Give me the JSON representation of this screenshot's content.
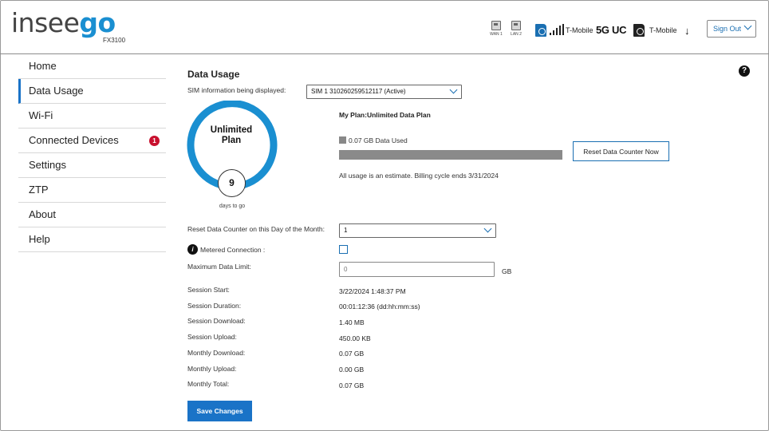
{
  "header": {
    "logo_prefix": "insee",
    "logo_suffix": "go",
    "model": "FX3100",
    "wan_label": "WAN 1",
    "lan_label": "LAN 2",
    "carrier1": "T-Mobile",
    "network_type": "5G UC",
    "carrier2": "T-Mobile",
    "download_arrow": "↓",
    "sign_out": "Sign Out"
  },
  "sidebar": {
    "items": [
      {
        "label": "Home"
      },
      {
        "label": "Data Usage",
        "active": true
      },
      {
        "label": "Wi-Fi"
      },
      {
        "label": "Connected Devices",
        "badge": "1"
      },
      {
        "label": "Settings"
      },
      {
        "label": "ZTP"
      },
      {
        "label": "About"
      },
      {
        "label": "Help"
      }
    ]
  },
  "help_icon": "?",
  "main": {
    "title": "Data Usage",
    "sim_label": "SIM information being displayed:",
    "sim_value": "SIM 1 310260259512117 (Active)",
    "gauge": {
      "plan_text": "Unlimited\nPlan",
      "days": "9",
      "days_label": "days to go",
      "ring_color": "#1a8fd1"
    },
    "plan_title": "My Plan:Unlimited Data Plan",
    "data_used": "0.07 GB Data Used",
    "usage_fraction": 0.0,
    "reset_counter_button": "Reset Data Counter Now",
    "estimate": "All usage is an estimate. Billing cycle ends 3/31/2024",
    "reset_day_label": "Reset Data Counter on this Day of the Month:",
    "reset_day_value": "1",
    "metered_label": "Metered Connection :",
    "metered_checked": false,
    "max_limit_label": "Maximum Data Limit:",
    "max_limit_placeholder": "0",
    "max_limit_unit": "GB",
    "stats": [
      {
        "label": "Session Start:",
        "value": "3/22/2024 1:48:37 PM"
      },
      {
        "label": "Session Duration:",
        "value": "00:01:12:36 (dd:hh:mm:ss)"
      },
      {
        "label": "Session Download:",
        "value": "1.40 MB"
      },
      {
        "label": "Session Upload:",
        "value": "450.00 KB"
      },
      {
        "label": "Monthly Download:",
        "value": "0.07 GB"
      },
      {
        "label": "Monthly Upload:",
        "value": "0.00 GB"
      },
      {
        "label": "Monthly Total:",
        "value": "0.07 GB"
      }
    ],
    "save_button": "Save Changes"
  },
  "colors": {
    "accent": "#1a73c7",
    "badge": "#c8102e"
  }
}
